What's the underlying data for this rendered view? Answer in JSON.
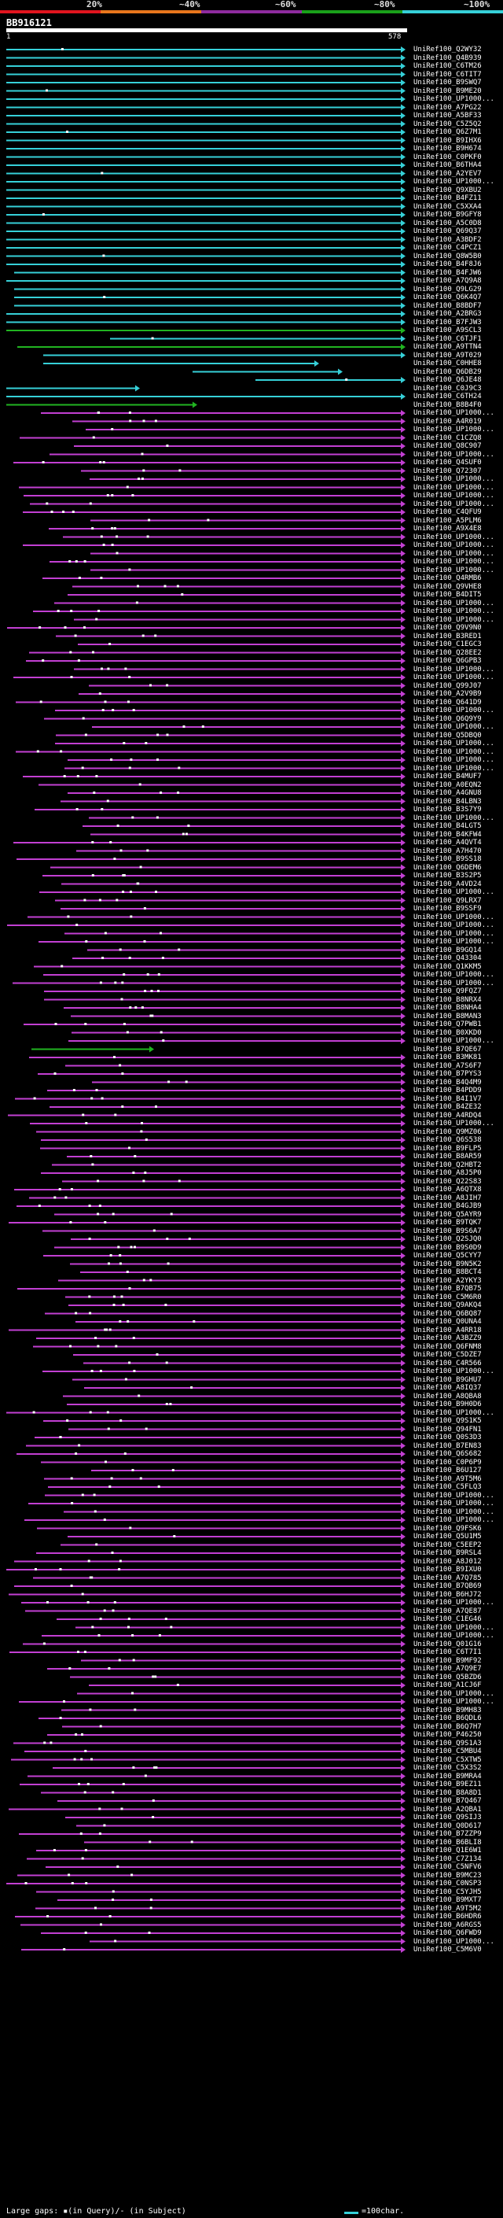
{
  "identity_scale": {
    "labels": [
      "20%",
      "~40%",
      "~60%",
      "~80%",
      "~100%"
    ],
    "colors": [
      "#e0141e",
      "#e8761c",
      "#8e2b9e",
      "#1aa01a",
      "#36d0d8"
    ]
  },
  "query": {
    "id": "BB916121",
    "start": "1",
    "end": "578"
  },
  "hit_colors": {
    "high": "#36d0d8",
    "medium": "#21b421",
    "low": "#c23fd2"
  },
  "icons": {
    "line_end": "arrow-head-icon",
    "gap_marker": "gap-dot-icon"
  },
  "hits": [
    "UniRef100_Q2WY32",
    "UniRef100_Q4B939",
    "UniRef100_C6TM26",
    "UniRef100_C6TIT7",
    "UniRef100_B9SWQ7",
    "UniRef100_B9ME20",
    "UniRef100_UP1000...",
    "UniRef100_A7PG22",
    "UniRef100_A5BF33",
    "UniRef100_C5Z5Q2",
    "UniRef100_Q6Z7M1",
    "UniRef100_B9IHX6",
    "UniRef100_B9H674",
    "UniRef100_C0PKF0",
    "UniRef100_B6THA4",
    "UniRef100_A2YEV7",
    "UniRef100_UP1000...",
    "UniRef100_Q9XBU2",
    "UniRef100_B4FZ11",
    "UniRef100_C5XXA4",
    "UniRef100_B9GFY8",
    "UniRef100_A5C0D8",
    "UniRef100_Q69Q37",
    "UniRef100_A3BDF2",
    "UniRef100_C4PCZ1",
    "UniRef100_Q8W5B0",
    "UniRef100_B4F8J6",
    "UniRef100_B4FJW6",
    "UniRef100_A7Q9A8",
    "UniRef100_Q9LG29",
    "UniRef100_Q6K4Q7",
    "UniRef100_B8BDF7",
    "UniRef100_A2BRG3",
    "UniRef100_B7FJW3",
    "UniRef100_A9SCL3",
    "UniRef100_C6TJF1",
    "UniRef100_A9TTN4",
    "UniRef100_A9T029",
    "UniRef100_C0HHE8",
    "UniRef100_Q6DB29",
    "UniRef100_Q6JE48",
    "UniRef100_C0J9C3",
    "UniRef100_C6TH24",
    "UniRef100_B8B4F0",
    "UniRef100_UP1000...",
    "UniRef100_A4R019",
    "UniRef100_UP1000...",
    "UniRef100_C1CZQ8",
    "UniRef100_Q8C907",
    "UniRef100_UP1000...",
    "UniRef100_Q4SUF0",
    "UniRef100_Q72307",
    "UniRef100_UP1000...",
    "UniRef100_UP1000...",
    "UniRef100_UP1000...",
    "UniRef100_UP1000...",
    "UniRef100_C4QFU9",
    "UniRef100_A5PLM6",
    "UniRef100_A9X4E8",
    "UniRef100_UP1000...",
    "UniRef100_UP1000...",
    "UniRef100_UP1000...",
    "UniRef100_UP1000...",
    "UniRef100_UP1000...",
    "UniRef100_Q4RMB6",
    "UniRef100_Q9VHE8",
    "UniRef100_B4DIT5",
    "UniRef100_UP1000...",
    "UniRef100_UP1000...",
    "UniRef100_UP1000...",
    "UniRef100_Q9V9N0",
    "UniRef100_B3RED1",
    "UniRef100_C1EGC3",
    "UniRef100_Q28EE2",
    "UniRef100_Q6GPB3",
    "UniRef100_UP1000...",
    "UniRef100_UP1000...",
    "UniRef100_Q99J07",
    "UniRef100_A2V9B9",
    "UniRef100_Q641D9",
    "UniRef100_UP1000...",
    "UniRef100_Q6Q9Y9",
    "UniRef100_UP1000...",
    "UniRef100_Q5DBQ0",
    "UniRef100_UP1000...",
    "UniRef100_UP1000...",
    "UniRef100_UP1000...",
    "UniRef100_UP1000...",
    "UniRef100_B4MUF7",
    "UniRef100_A0EQN2",
    "UniRef100_A4GNU8",
    "UniRef100_B4LBN3",
    "UniRef100_B3S7Y9",
    "UniRef100_UP1000...",
    "UniRef100_B4LGT5",
    "UniRef100_B4KFW4",
    "UniRef100_A4QVT4",
    "UniRef100_A7H470",
    "UniRef100_B9SS18",
    "UniRef100_Q6DEM6",
    "UniRef100_B3S2P5",
    "UniRef100_A4VD24",
    "UniRef100_UP1000...",
    "UniRef100_Q9LRX7",
    "UniRef100_B9SSF9",
    "UniRef100_UP1000...",
    "UniRef100_UP1000...",
    "UniRef100_UP1000...",
    "UniRef100_UP1000...",
    "UniRef100_B9GQ14",
    "UniRef100_Q43304",
    "UniRef100_Q1KKM5",
    "UniRef100_UP1000...",
    "UniRef100_UP1000...",
    "UniRef100_Q9FQZ7",
    "UniRef100_B8NRX4",
    "UniRef100_B8NHA4",
    "UniRef100_B8MAN3",
    "UniRef100_Q7PWB1",
    "UniRef100_B0XKD0",
    "UniRef100_UP1000...",
    "UniRef100_B7QE67",
    "UniRef100_B3MK81",
    "UniRef100_A7S6F7",
    "UniRef100_B7PYS3",
    "UniRef100_B4Q4M9",
    "UniRef100_B4PDD9",
    "UniRef100_B4I1V7",
    "UniRef100_B4ZE32",
    "UniRef100_A4RDQ4",
    "UniRef100_UP1000...",
    "UniRef100_Q9MZ06",
    "UniRef100_Q6S538",
    "UniRef100_B9FLP5",
    "UniRef100_B8AR59",
    "UniRef100_Q2HBT2",
    "UniRef100_A8J5P0",
    "UniRef100_Q22S83",
    "UniRef100_A6QTX8",
    "UniRef100_A8JIH7",
    "UniRef100_B4GJB9",
    "UniRef100_Q5AYR9",
    "UniRef100_B9TQK7",
    "UniRef100_B9S6A7",
    "UniRef100_Q2SJQ0",
    "UniRef100_B9S0D9",
    "UniRef100_Q5CYY7",
    "UniRef100_B9N5K2",
    "UniRef100_B8BCT4",
    "UniRef100_A2YKY3",
    "UniRef100_B7QB75",
    "UniRef100_C5M6R0",
    "UniRef100_Q9AKQ4",
    "UniRef100_Q6BQ87",
    "UniRef100_Q0UNA4",
    "UniRef100_A4RR18",
    "UniRef100_A3BZZ9",
    "UniRef100_Q6FNM8",
    "UniRef100_C5DZE7",
    "UniRef100_C4R566",
    "UniRef100_UP1000...",
    "UniRef100_B9GHU7",
    "UniRef100_A8IQ37",
    "UniRef100_A8QBA8",
    "UniRef100_B9H0D6",
    "UniRef100_UP1000...",
    "UniRef100_Q9S1K5",
    "UniRef100_Q94FN1",
    "UniRef100_Q0S3D3",
    "UniRef100_B7EN83",
    "UniRef100_Q6S682",
    "UniRef100_C0P6P9",
    "UniRef100_B6U127",
    "UniRef100_A9T5M6",
    "UniRef100_C5FLQ3",
    "UniRef100_UP1000...",
    "UniRef100_UP1000...",
    "UniRef100_UP1000...",
    "UniRef100_UP1000...",
    "UniRef100_Q9FSK6",
    "UniRef100_Q5U1M5",
    "UniRef100_C5EEP2",
    "UniRef100_B9RSL4",
    "UniRef100_A8J012",
    "UniRef100_B9IXU0",
    "UniRef100_A7Q785",
    "UniRef100_B7QB69",
    "UniRef100_B6HJ72",
    "UniRef100_UP1000...",
    "UniRef100_A7QE87",
    "UniRef100_C1EG46",
    "UniRef100_UP1000...",
    "UniRef100_UP1000...",
    "UniRef100_Q01G16",
    "UniRef100_C6T7I1",
    "UniRef100_B9MF92",
    "UniRef100_A7Q9E7",
    "UniRef100_Q5BZD6",
    "UniRef100_A1CJ6F",
    "UniRef100_UP1000...",
    "UniRef100_UP1000...",
    "UniRef100_B9MH83",
    "UniRef100_B6QDL6",
    "UniRef100_B6Q7H7",
    "UniRef100_P46250",
    "UniRef100_Q9S1A3",
    "UniRef100_C5MBU4",
    "UniRef100_C5XTW5",
    "UniRef100_C5X3S2",
    "UniRef100_B9MRA4",
    "UniRef100_B9EZ11",
    "UniRef100_B8A8D1",
    "UniRef100_B7Q467",
    "UniRef100_A2QBA1",
    "UniRef100_Q9SIJ3",
    "UniRef100_Q0D617",
    "UniRef100_B7ZZP9",
    "UniRef100_B6BLI8",
    "UniRef100_Q1E6W1",
    "UniRef100_C7Z134",
    "UniRef100_C5NFV6",
    "UniRef100_B9MC23",
    "UniRef100_C0NSP3",
    "UniRef100_C5YJH5",
    "UniRef100_B9MXT7",
    "UniRef100_A9T5M2",
    "UniRef100_B6HDR6",
    "UniRef100_A6RGS5",
    "UniRef100_Q6FWD9",
    "UniRef100_UP1000...",
    "UniRef100_C5M6V0"
  ],
  "legend": {
    "left_text": "Large gaps: ▪(in Query)/- (in Subject)",
    "right_text": "=100char."
  }
}
